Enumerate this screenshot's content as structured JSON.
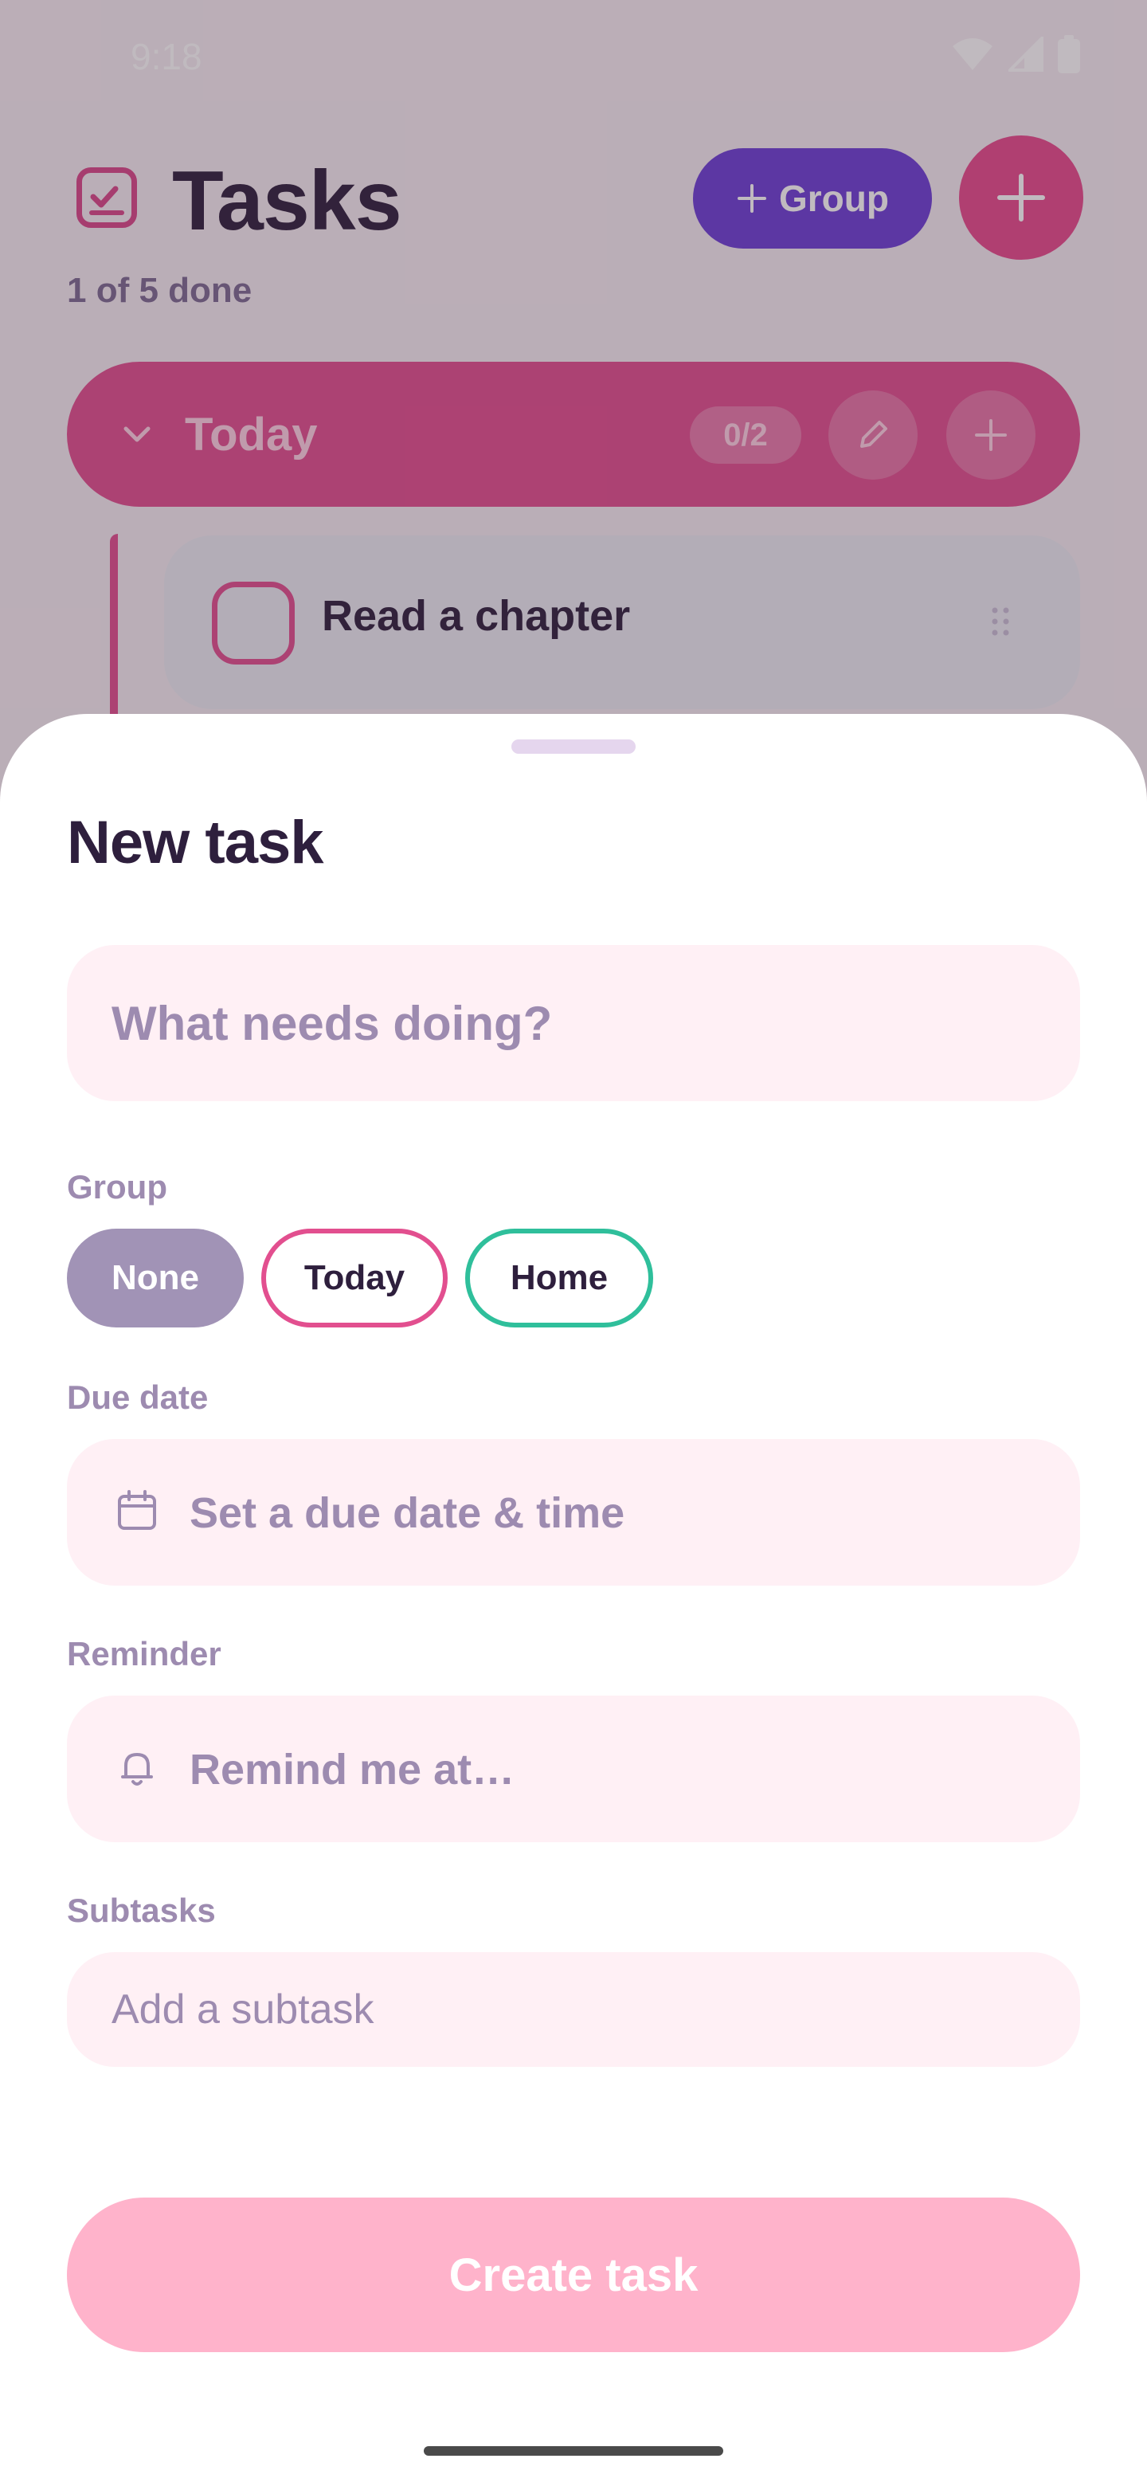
{
  "status_bar": {
    "time": "9:18"
  },
  "header": {
    "title": "Tasks",
    "subtitle": "1 of 5 done",
    "group_button_label": "Group"
  },
  "groups": [
    {
      "name": "Today",
      "count": "0/2",
      "tasks": [
        {
          "title": "Read a chapter"
        }
      ]
    }
  ],
  "sheet": {
    "title": "New task",
    "task_placeholder": "What needs doing?",
    "group_label": "Group",
    "group_options": [
      "None",
      "Today",
      "Home"
    ],
    "selected_group": "None",
    "due_label": "Due date",
    "due_placeholder": "Set a due date & time",
    "reminder_label": "Reminder",
    "reminder_placeholder": "Remind me at…",
    "subtasks_label": "Subtasks",
    "subtask_placeholder": "Add a subtask",
    "create_label": "Create task"
  },
  "colors": {
    "accent_pink": "#e24f8f",
    "accent_purple": "#6c3fd6",
    "home_group": "#2fbf9b",
    "create_disabled": "#ffb3cb"
  }
}
